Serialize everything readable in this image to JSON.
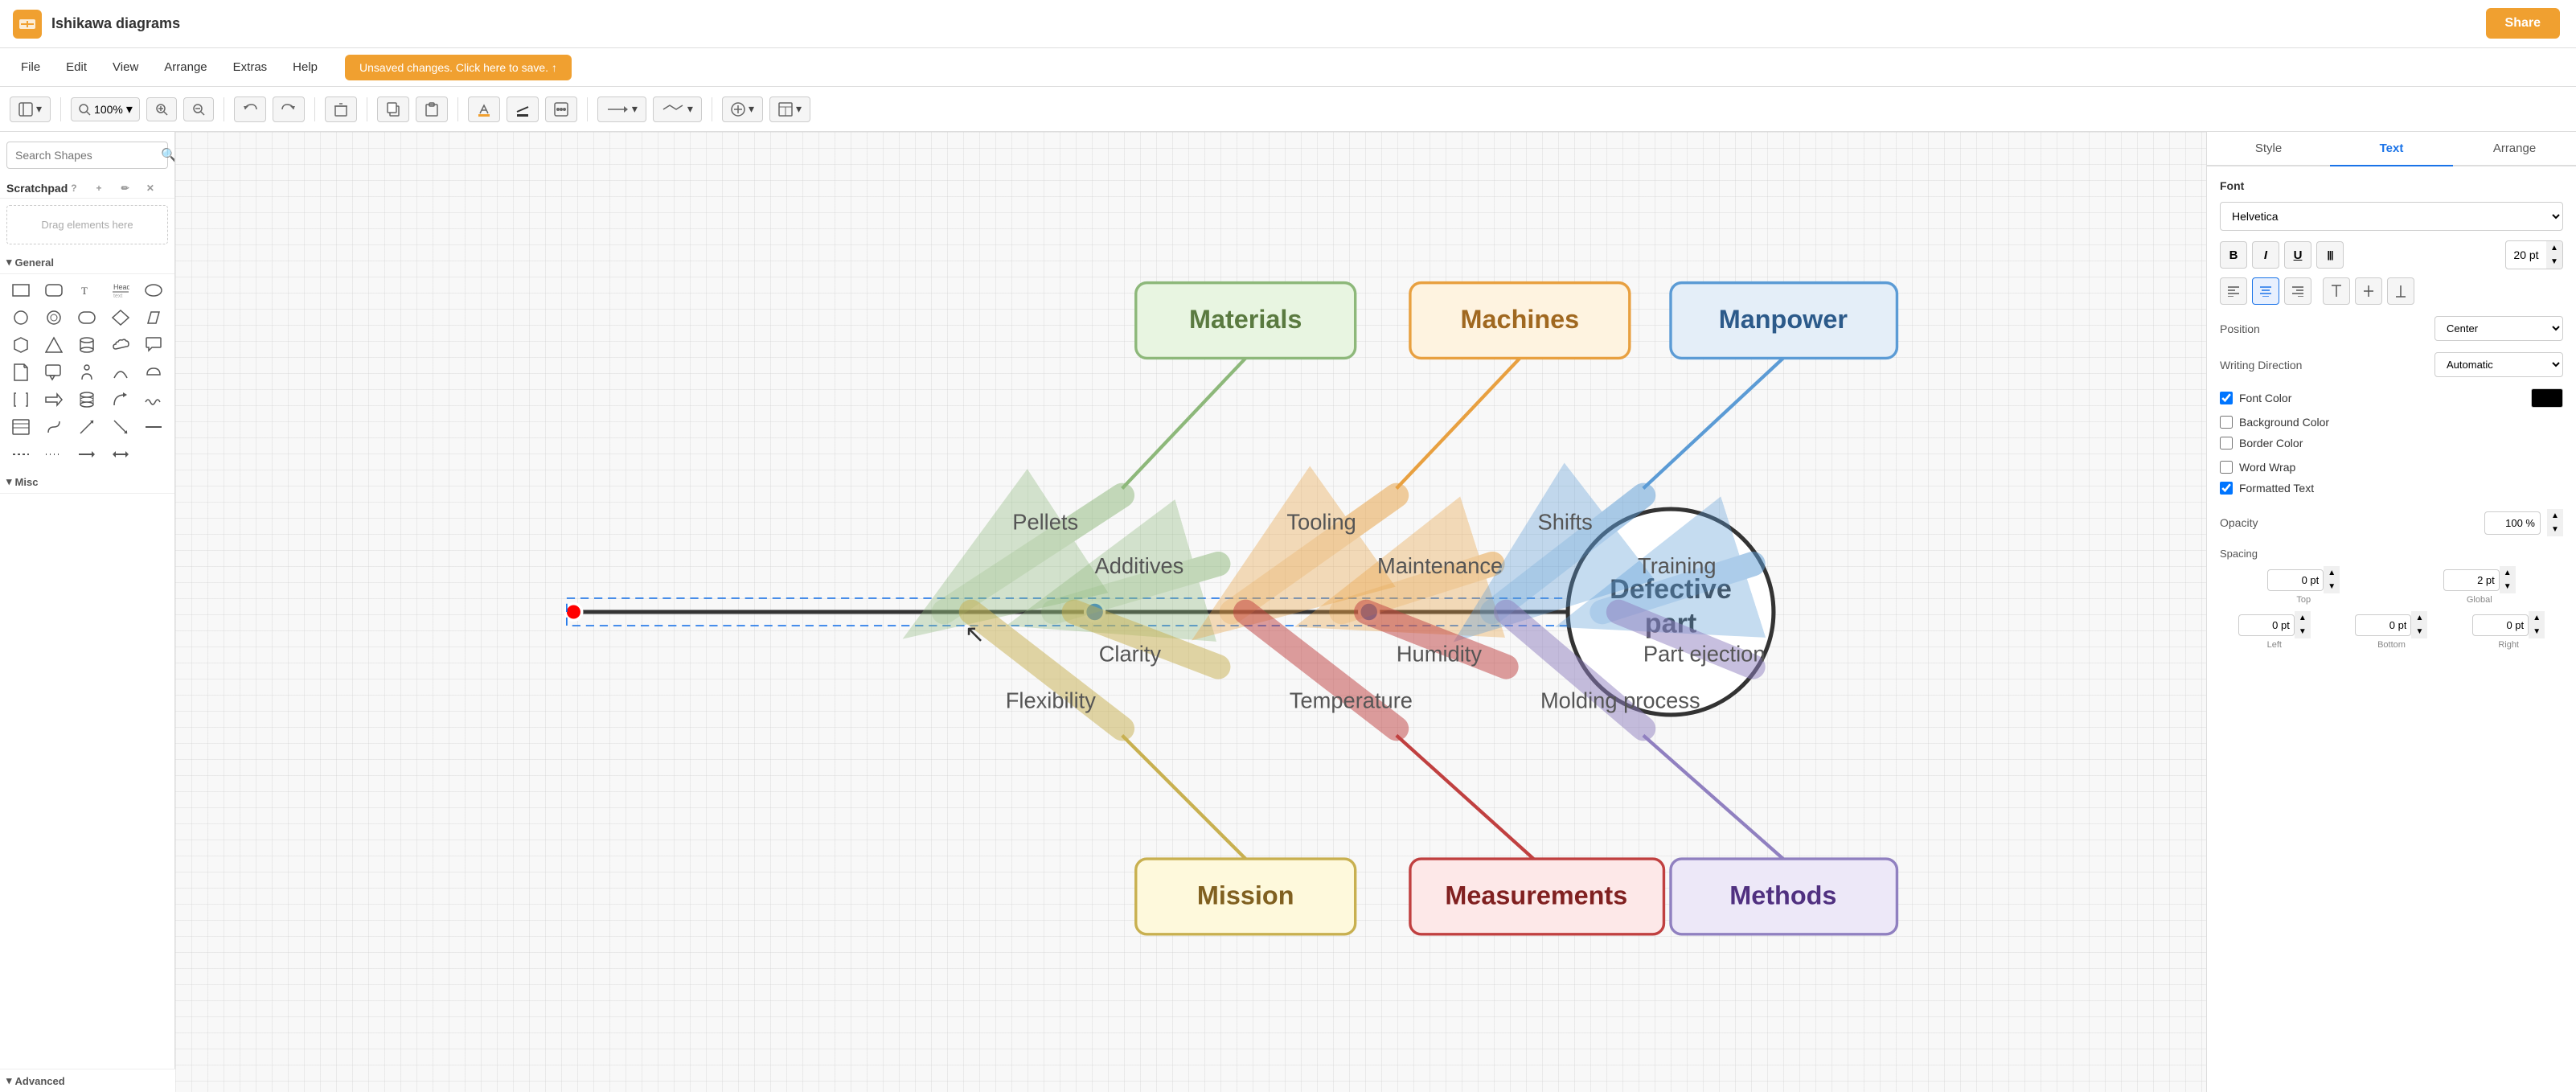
{
  "app": {
    "title": "Ishikawa diagrams",
    "icon_label": "D"
  },
  "titlebar": {
    "share_label": "Share"
  },
  "menubar": {
    "items": [
      "File",
      "Edit",
      "View",
      "Arrange",
      "Extras",
      "Help"
    ],
    "unsaved_label": "Unsaved changes. Click here to save. ↑"
  },
  "toolbar": {
    "zoom_level": "100%",
    "format_label": "Format"
  },
  "sidebar": {
    "search_placeholder": "Search Shapes",
    "scratchpad_label": "Scratchpad",
    "drag_label": "Drag elements here",
    "general_label": "General",
    "misc_label": "Misc",
    "advanced_label": "Advanced"
  },
  "diagram": {
    "nodes": [
      {
        "id": "materials",
        "label": "Materials",
        "color": "#8db87a",
        "bg": "#e8f5e1"
      },
      {
        "id": "machines",
        "label": "Machines",
        "color": "#e8a040",
        "bg": "#fef3e0"
      },
      {
        "id": "manpower",
        "label": "Manpower",
        "color": "#5b9bd5",
        "bg": "#e4eef8"
      },
      {
        "id": "mission",
        "label": "Mission",
        "color": "#c8b050",
        "bg": "#fef9dc"
      },
      {
        "id": "measurements",
        "label": "Measurements",
        "color": "#c04040",
        "bg": "#fde8e8"
      },
      {
        "id": "methods",
        "label": "Methods",
        "color": "#9080c0",
        "bg": "#ede8f8"
      }
    ],
    "arrows": [
      {
        "label": "Pellets"
      },
      {
        "label": "Tooling"
      },
      {
        "label": "Shifts"
      },
      {
        "label": "Additives"
      },
      {
        "label": "Maintenance"
      },
      {
        "label": "Training"
      },
      {
        "label": "Flexibility"
      },
      {
        "label": "Temperature"
      },
      {
        "label": "Molding process"
      },
      {
        "label": "Clarity"
      },
      {
        "label": "Humidity"
      },
      {
        "label": "Part ejection"
      }
    ],
    "effect_label": "Defective\npart"
  },
  "right_panel": {
    "tabs": [
      "Style",
      "Text",
      "Arrange"
    ],
    "active_tab": "Text",
    "font": {
      "section_label": "Font",
      "font_name": "Helvetica",
      "bold_label": "B",
      "italic_label": "I",
      "underline_label": "U",
      "strikethrough_label": "|||",
      "font_size": "20 pt"
    },
    "alignment": {
      "position_label": "Position",
      "position_value": "Center",
      "writing_dir_label": "Writing Direction",
      "writing_dir_value": "Automatic"
    },
    "color": {
      "font_color_label": "Font Color",
      "font_color_enabled": true,
      "font_color_value": "#000000",
      "bg_color_label": "Background Color",
      "bg_color_enabled": false,
      "border_color_label": "Border Color",
      "border_color_enabled": false
    },
    "word_wrap_label": "Word Wrap",
    "word_wrap_enabled": false,
    "formatted_text_label": "Formatted Text",
    "formatted_text_enabled": true,
    "opacity_label": "Opacity",
    "opacity_value": "100 %",
    "spacing": {
      "label": "Spacing",
      "top_value": "0 pt",
      "top_label": "Top",
      "global_value": "2 pt",
      "global_label": "Global",
      "left_value": "0 pt",
      "left_label": "Left",
      "bottom_value": "0 pt",
      "bottom_label": "Bottom",
      "right_value": "0 pt",
      "right_label": "Right"
    }
  }
}
